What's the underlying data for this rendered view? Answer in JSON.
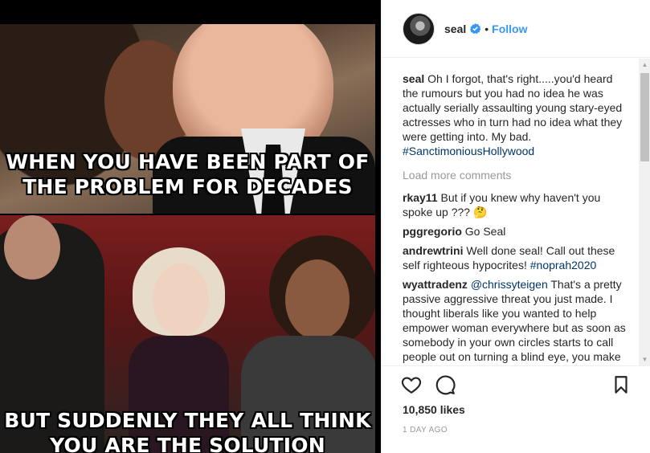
{
  "media": {
    "caption_top_line1": "WHEN YOU HAVE BEEN PART OF",
    "caption_top_line2": "THE PROBLEM FOR DECADES",
    "caption_bot_line1": "BUT SUDDENLY THEY ALL THINK",
    "caption_bot_line2": "YOU ARE THE SOLUTION"
  },
  "header": {
    "username": "seal",
    "separator": "•",
    "follow_label": "Follow",
    "verified_icon": "verified-badge-icon"
  },
  "post": {
    "author": "seal",
    "text": "Oh I forgot, that's right.....you'd heard the rumours but you had no idea he was actually serially assaulting young stary-eyed actresses who in turn had no idea what they were getting into. My bad.",
    "hashtag": "#SanctimoniousHollywood"
  },
  "load_more": "Load more comments",
  "comments": [
    {
      "user": "rkay11",
      "text": "But if you knew why haven't you spoke up ??? 🤔"
    },
    {
      "user": "pggregorio",
      "text": "Go Seal"
    },
    {
      "user": "andrewtrini",
      "text": "Well done seal! Call out these self righteous hypocrites!",
      "hashtag": "#noprah2020"
    },
    {
      "user": "wyattradenz",
      "mention": "@chrissyteigen",
      "text": "That's a pretty passive aggressive threat you just made. I thought liberals like you wanted to help empower woman everywhere but as soon as somebody in your own circles starts to call people out on turning a blind eye, you make a threat towards him suggesting that"
    }
  ],
  "actions": {
    "like_icon": "heart-icon",
    "comment_icon": "comment-bubble-icon",
    "save_icon": "bookmark-icon",
    "likes": "10,850 likes",
    "time": "1 DAY AGO"
  },
  "colors": {
    "link": "#3897f0",
    "hashtag": "#003569",
    "muted": "#999999",
    "text": "#262626"
  }
}
